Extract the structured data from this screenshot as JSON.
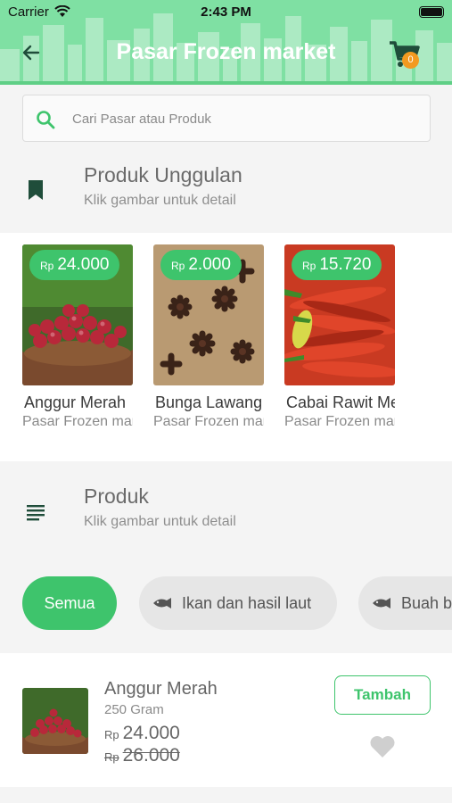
{
  "status_bar": {
    "carrier": "Carrier",
    "time": "2:43 PM"
  },
  "header": {
    "title": "Pasar Frozen market",
    "cart_count": "0"
  },
  "search": {
    "placeholder": "Cari Pasar atau Produk"
  },
  "featured_section": {
    "title": "Produk Unggulan",
    "subtitle": "Klik gambar untuk detail",
    "items": [
      {
        "currency": "Rp",
        "price": "24.000",
        "name": "Anggur Merah",
        "market": "Pasar Frozen market"
      },
      {
        "currency": "Rp",
        "price": "2.000",
        "name": "Bunga Lawang",
        "market": "Pasar Frozen market"
      },
      {
        "currency": "Rp",
        "price": "15.720",
        "name": "Cabai Rawit Merah",
        "market": "Pasar Frozen market"
      }
    ]
  },
  "products_section": {
    "title": "Produk",
    "subtitle": "Klik gambar untuk detail"
  },
  "categories": [
    {
      "label": "Semua",
      "active": true
    },
    {
      "label": "Ikan dan hasil laut",
      "active": false
    },
    {
      "label": "Buah buahan",
      "active": false
    }
  ],
  "products": [
    {
      "name": "Anggur Merah",
      "weight": "250 Gram",
      "currency": "Rp",
      "price": "24.000",
      "old_price": "26.000",
      "add_label": "Tambah"
    }
  ],
  "colors": {
    "header_bg": "#7fe0a3",
    "accent": "#3ec46c",
    "badge": "#f29a20",
    "icon_dark": "#1f4d3a"
  }
}
